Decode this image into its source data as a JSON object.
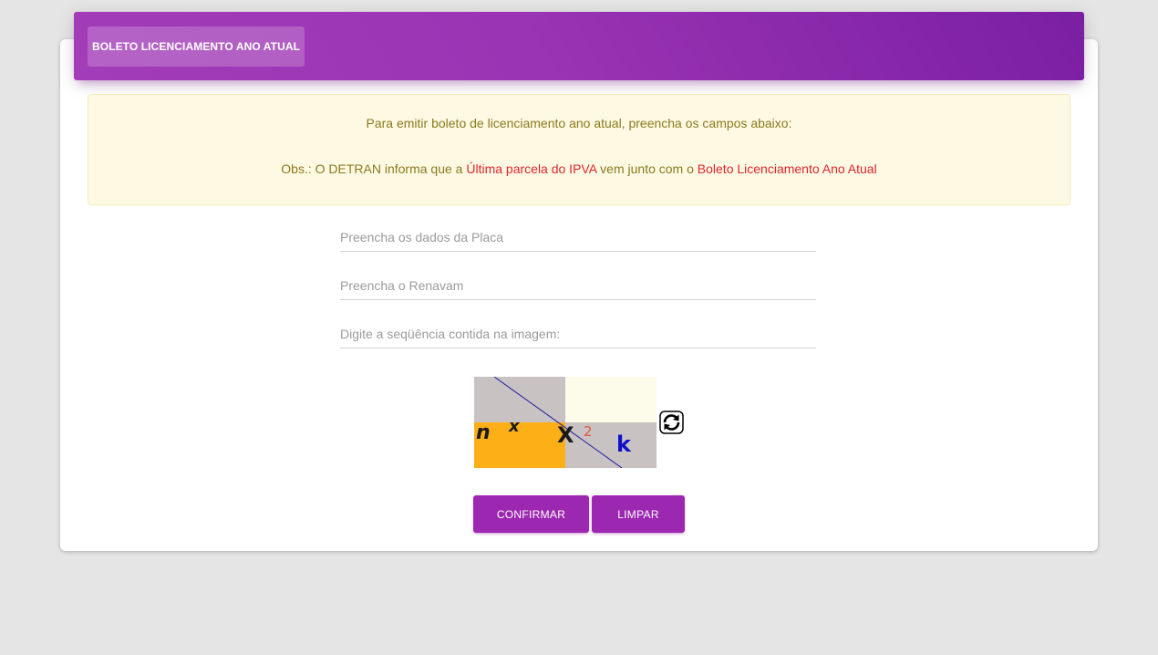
{
  "header": {
    "tab_label": "BOLETO LICENCIAMENTO ANO ATUAL",
    "gradient_start": "#a33cb8",
    "gradient_end": "#7b1fa2"
  },
  "notice": {
    "line1": "Para emitir boleto de licenciamento ano atual, preencha os campos abaixo:",
    "line2_prefix": "Obs.: O DETRAN informa que a ",
    "line2_highlight1": "Última parcela do IPVA",
    "line2_middle": " vem junto com o ",
    "line2_highlight2": "Boleto Licenciamento Ano Atual",
    "text_color": "#8a7a1e",
    "highlight_color": "#e0252e",
    "background": "#fdf9e3"
  },
  "form": {
    "placa_placeholder": "Preencha os dados da Placa",
    "placa_value": "",
    "renavam_placeholder": "Preencha o Renavam",
    "renavam_value": "",
    "captcha_placeholder": "Digite a seqüência contida na imagem:",
    "captcha_value": ""
  },
  "captcha": {
    "characters": [
      "n",
      "x",
      "X",
      "2",
      "k"
    ],
    "refresh_icon": "refresh-icon"
  },
  "buttons": {
    "confirm_label": "CONFIRMAR",
    "clear_label": "LIMPAR",
    "color": "#9c27b0"
  }
}
